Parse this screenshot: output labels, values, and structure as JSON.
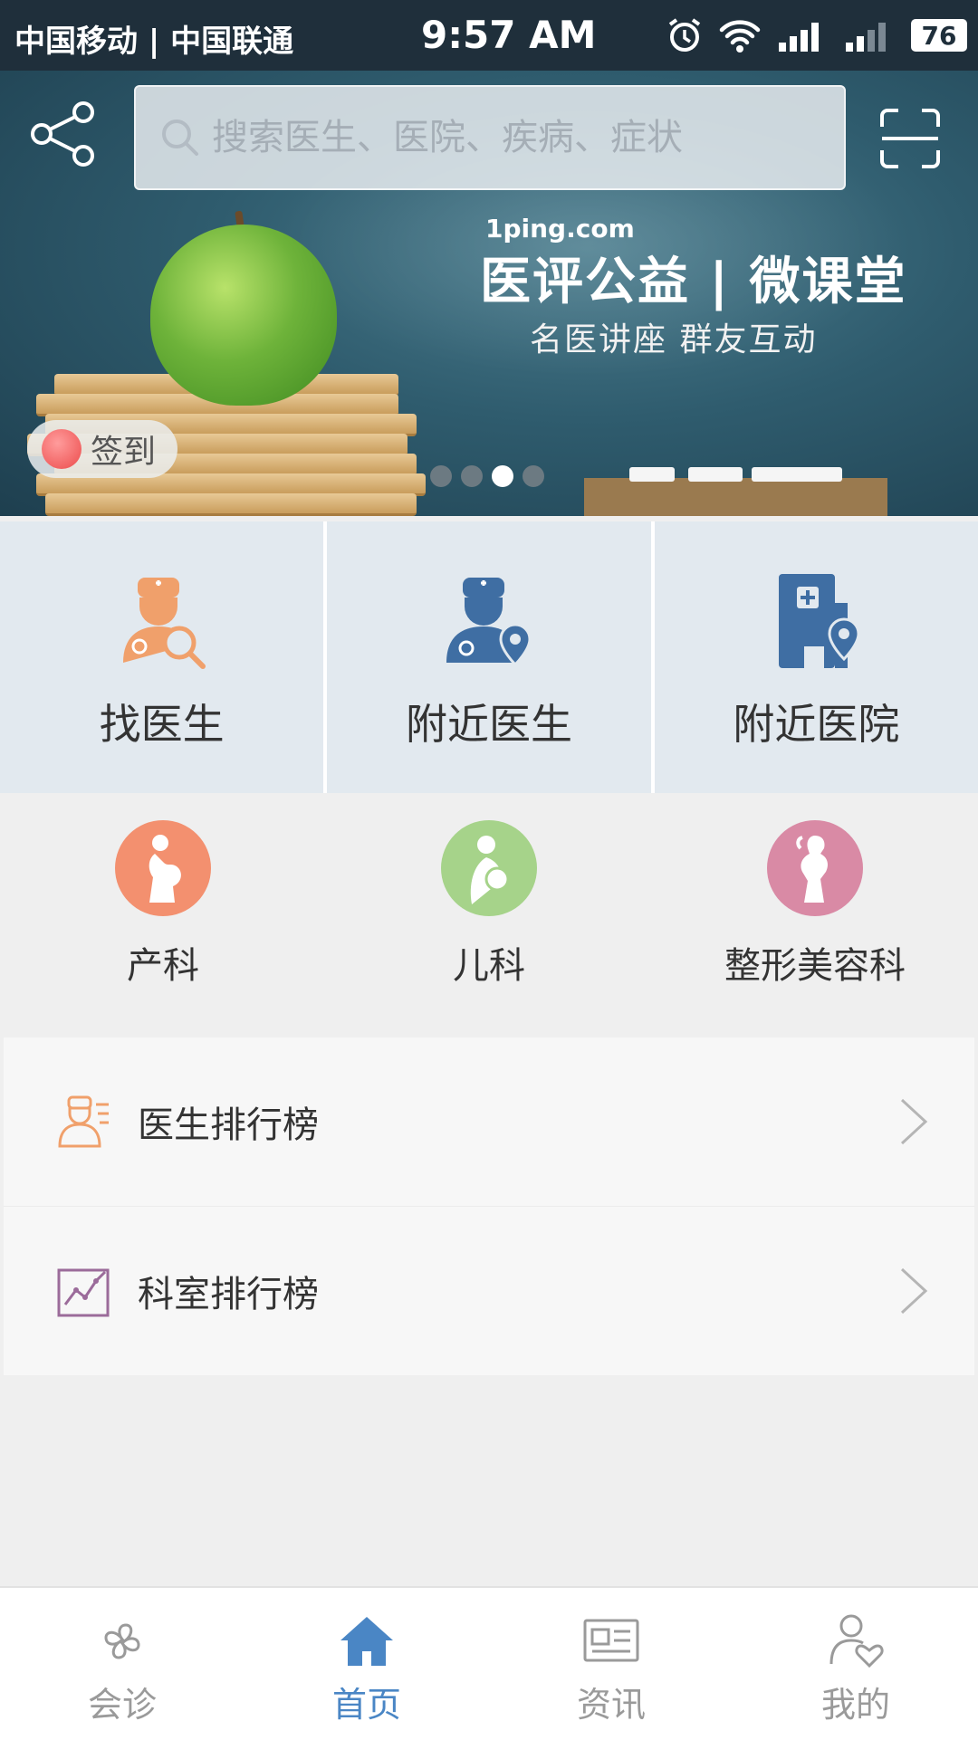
{
  "status_bar": {
    "carrier": "中国移动 | 中国联通",
    "time": "9:57 AM",
    "battery": "76"
  },
  "header": {
    "search_placeholder": "搜索医生、医院、疾病、症状"
  },
  "banner": {
    "domain": "1ping.com",
    "title": "医评公益 | 微课堂",
    "subtitle": "名医讲座 群友互动",
    "signin_label": "签到",
    "page_count": 4,
    "active_page": 3
  },
  "features": [
    {
      "label": "找医生",
      "icon": "find-doctor-icon"
    },
    {
      "label": "附近医生",
      "icon": "nearby-doctor-icon"
    },
    {
      "label": "附近医院",
      "icon": "nearby-hospital-icon"
    }
  ],
  "categories": [
    {
      "label": "产科",
      "icon": "pregnant-woman-icon",
      "color": "#f3906f"
    },
    {
      "label": "儿科",
      "icon": "mother-baby-icon",
      "color": "#a6d38a"
    },
    {
      "label": "整形美容科",
      "icon": "woman-silhouette-icon",
      "color": "#d98aa5"
    }
  ],
  "rankings": [
    {
      "label": "医生排行榜",
      "icon": "doctor-list-icon"
    },
    {
      "label": "科室排行榜",
      "icon": "trend-chart-icon"
    }
  ],
  "tabs": [
    {
      "label": "会诊",
      "icon": "clover-icon"
    },
    {
      "label": "首页",
      "icon": "home-icon"
    },
    {
      "label": "资讯",
      "icon": "news-icon"
    },
    {
      "label": "我的",
      "icon": "profile-heart-icon"
    }
  ],
  "colors": {
    "accent": "#4a86c5",
    "feature_icon_blue": "#3f6ea3",
    "feature_icon_orange": "#f0a06b"
  }
}
